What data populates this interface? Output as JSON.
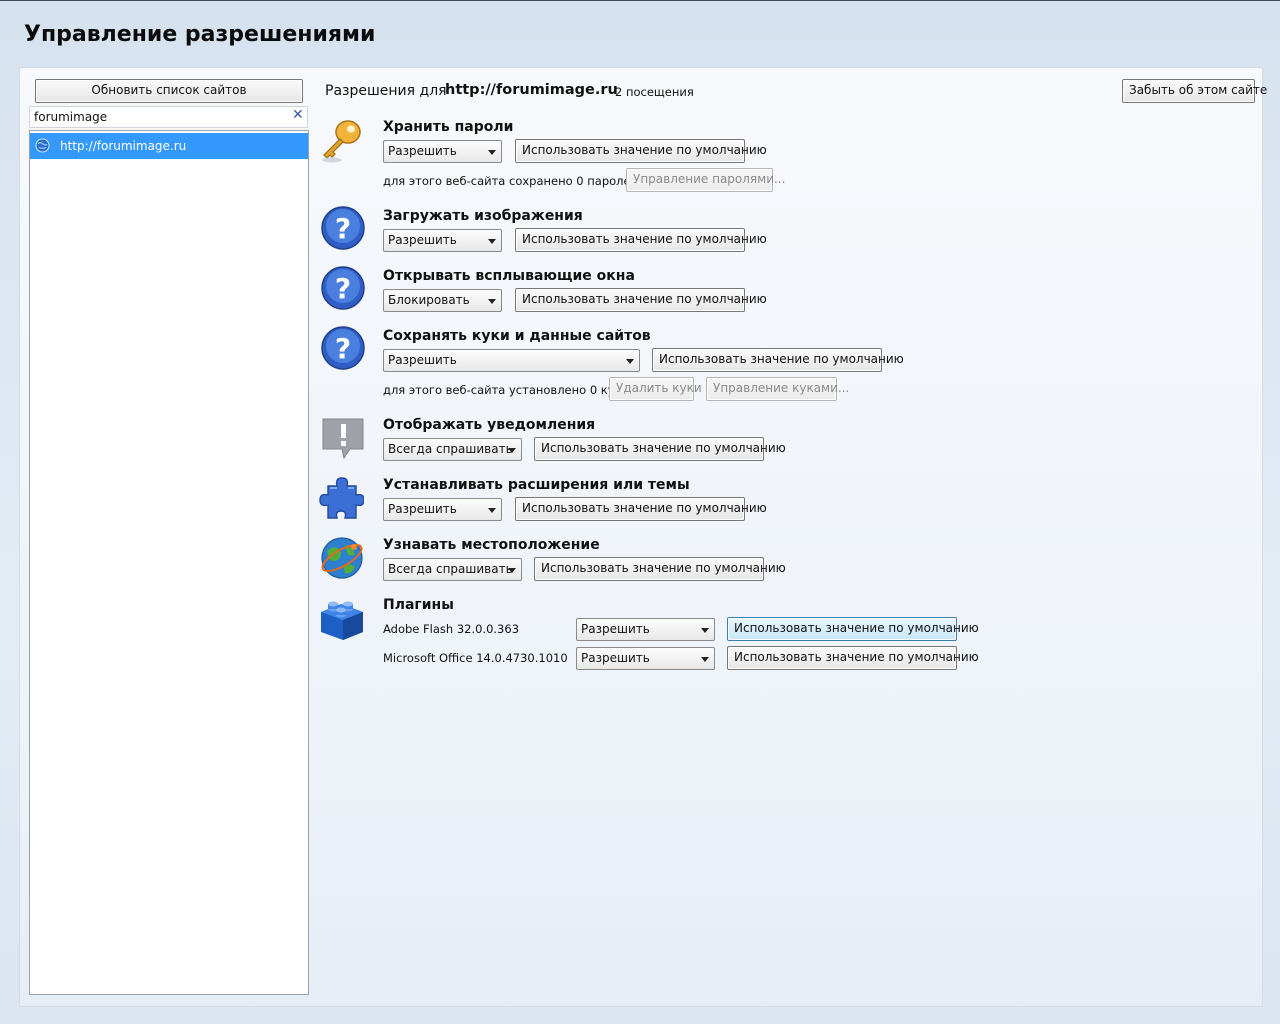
{
  "page_title": "Управление разрешениями",
  "sidebar": {
    "refresh_label": "Обновить список сайтов",
    "search_value": "forumimage",
    "clear_glyph": "✕",
    "sites": [
      "http://forumimage.ru"
    ]
  },
  "header": {
    "prefix": "Разрешения для",
    "site": "http://forumimage.ru",
    "visits": "2 посещения",
    "forget_label": "Забыть об этом сайте"
  },
  "default_label": "Использовать значение по умолчанию",
  "permissions": {
    "passwords": {
      "title": "Хранить пароли",
      "value": "Разрешить",
      "note": "для этого веб-сайта сохранено 0 паролей.",
      "manage_label": "Управление паролями...",
      "icon": "key-icon"
    },
    "images": {
      "title": "Загружать изображения",
      "value": "Разрешить",
      "icon": "question-icon"
    },
    "popups": {
      "title": "Открывать всплывающие окна",
      "value": "Блокировать",
      "icon": "question-icon"
    },
    "cookies": {
      "title": "Сохранять куки и данные сайтов",
      "value": "Разрешить",
      "note": "для этого веб-сайта установлено 0 кук.",
      "delete_label": "Удалить куки",
      "manage_label": "Управление куками...",
      "icon": "question-icon"
    },
    "notifications": {
      "title": "Отображать уведомления",
      "value": "Всегда спрашивать",
      "icon": "speech-bubble-alert-icon"
    },
    "install": {
      "title": "Устанавливать расширения или темы",
      "value": "Разрешить",
      "icon": "puzzle-piece-icon"
    },
    "geo": {
      "title": "Узнавать местоположение",
      "value": "Всегда спрашивать",
      "icon": "globe-icon"
    },
    "plugins": {
      "title": "Плагины",
      "icon": "lego-brick-icon",
      "items": [
        {
          "name": "Adobe Flash 32.0.0.363",
          "value": "Разрешить"
        },
        {
          "name": "Microsoft Office 14.0.4730.1010",
          "value": "Разрешить"
        }
      ]
    }
  },
  "colors": {
    "accent": "#3399ff",
    "icon_blue": "#2f5fc4",
    "key_gold": "#e6a623"
  }
}
